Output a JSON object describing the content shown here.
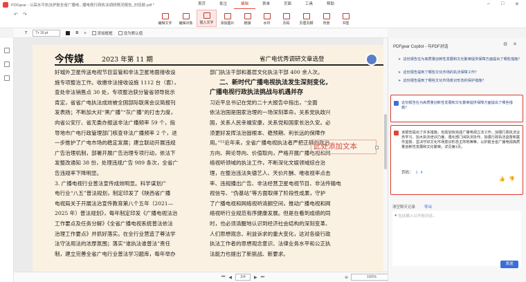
{
  "window": {
    "title": "PDFgear - 以高水平执法护航全省广播电...播电视行政执法调研情况报告_刘佳颖.pdf *",
    "minimize": "–",
    "maximize": "□",
    "close": "✕"
  },
  "menu": [
    "首页",
    "批注",
    "编辑",
    "表单",
    "页面",
    "工具",
    "帮助"
  ],
  "menu_active": "编辑",
  "ribbon": {
    "undo_icons": [
      "undo-icon",
      "redo-icon",
      "split-icon",
      "rotate-icon"
    ],
    "tools": [
      {
        "label": "编辑文字",
        "icon": "edit-text-icon"
      },
      {
        "label": "编辑对象",
        "icon": "edit-object-icon"
      },
      {
        "label": "插入文字",
        "icon": "insert-text-icon",
        "active": true
      },
      {
        "label": "添加图片",
        "icon": "add-image-icon"
      },
      {
        "label": "链接",
        "icon": "link-icon"
      },
      {
        "label": "水印",
        "icon": "watermark-icon"
      },
      {
        "label": "页码",
        "icon": "page-number-icon"
      },
      {
        "label": "页眉页脚",
        "icon": "header-footer-icon"
      },
      {
        "label": "背景",
        "icon": "background-icon"
      },
      {
        "label": "书签",
        "icon": "bookmark-icon"
      }
    ]
  },
  "subbar": {
    "font_size": "16 pt",
    "border_label": "添加框框",
    "default_label": "设为默认值"
  },
  "document": {
    "header_left": "今传媒",
    "header_issue": "2023 年第 11 期",
    "header_right": "省广电优秀调研文章选登",
    "left_column": [
      "好城外卫星传送电视节目监管和非法卫星地面接收设",
      "施专项整治工作。收缴非法接收设施 1112 台（套），",
      "查处非法销售点 30 处，专项整治获分管省领导批示",
      "肯定，省省广电执法成效被全国部际联席会议简报刊",
      "发表扬；不断加大对“黑广播”“灰广播”的打击力度，",
      "向省公安厅、省无委办报送非法广播频率 59 个，指",
      "导地市广电行政管理部门核查非法广播频率 2 个，进",
      "一步推护了广电市场的稳定发展；建立联动开展违规",
      "广告治理机制，部署开展广告治理专项行动，依法下",
      "发整改通知 38 份，处理违规广告 989 条次，全省广",
      "告违规率下降明显。",
      "    3. 广播电视行业普法宣传成效明显。科学谋划广",
      "电行业“八五”普法规划，制定印发了《陕西省广播",
      "电视局关于开展法治宣传教育第八个五年（2021—",
      "2025 年）普法规划》，每年制定印发《广播电视法治",
      "工作要点及任务分解》《全省广播电视系统普法依法",
      "治理工作要点》并抓好落实。在全行业营造了尊法学",
      "法守法用法的浓厚氛围；落实“谁执法谁普法”责任",
      "制，建立完善全省广电行业普法学习题库，每年举办"
    ],
    "right_intro": "部门执法干部和基层文化执法干部 400 余人次。",
    "right_heading1": "二、新时代广播电视执法发生深刻变化，",
    "right_heading2": "广播电视行政执法挑战与机遇并存",
    "right_column": [
      "    习近平总书记在党的二十大报告中指出，“全面",
      "依法治国是国家治理的一场深刻革命，关系党执政兴",
      "国，关系人民幸福安康，关系党和国家长治久安。必",
      "须更好发挥法治固根本、稳预期、利长远的保障作",
      "用。”¹¹近年来，全省广播电视执法者严把正确的政治",
      "方向、舆论导向、价值取向，严格开展广播电视和网",
      "络视听领域的执法工作，不断深化文娱领域综合治",
      "理，在整治违法失德艺人、天价片酬、唯收视率点击",
      "率、违规播出广告、非法经营卫星电视节目、非法传输电",
      "视信号、“伪基站”等方面取得了阶段性成果，守护",
      "了广播电视和网络视听清朗空间，推动广播电视和网",
      "络视听行业规范有序健康发展。但是在看到成绩的同",
      "时，也必须清醒地认识到经济社会结构的深刻变革、",
      "人们思想观念、利益诉求的重大变化，这对各级行政",
      "执法工作者的思想观念意识、法律业务水平和公正执",
      "法能力也提出了新挑战、新要求。"
    ],
    "inserted_text": "此处添加文本"
  },
  "statusbar": {
    "page_current": "2",
    "page_total": "/4",
    "zoom": "165%"
  },
  "copilot": {
    "title": "PDFgear Copilot - 与PDF对话",
    "suggested_questions": [
      "这份报告在为高质量创新性发展和文化繁荣提供保障方面提出了哪些措施？",
      "这份报告提到了哪些文化市场的执法保障工作？",
      "这份报告提到了哪些文化市场意识形态的保护措施？"
    ],
    "user_message": "这份报告在为高质量创新性发展和文化繁荣提供保障方面提出了哪些措施？",
    "ai_message": "该报告提出了许多措施，包括加快完成广播电视立法工作、加强行政执法业务学习、加大执法培训力度、强化部门间执法协作、加强行政执法监督和案件监督、坚决守好文化市场意识形态主阵地等等，以护航全省广播电视高质量创新性发展和文化繁荣。详见第1页。",
    "pages_label": "页码：",
    "pages": [
      "1",
      "4"
    ],
    "clear_label": "清空聊天记录",
    "export_label": "导出",
    "input_placeholder": "在此输入以开始对话...",
    "send_label": "发送"
  }
}
